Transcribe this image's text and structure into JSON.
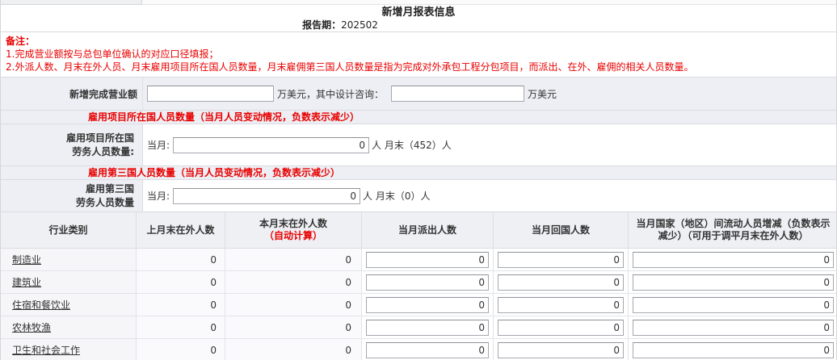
{
  "colors": {
    "accent_red": "#e80000",
    "section_bg": "#edeff4",
    "border": "#d9dbe0",
    "header_bg": "#eff0f4"
  },
  "header": {
    "title": "新增月报表信息",
    "report_period_label": "报告期：",
    "report_period_value": "202502"
  },
  "notes": {
    "label": "备注：",
    "line1": "1.完成营业额按与总包单位确认的对应口径填报；",
    "line2": "2.外派人数、月末在外人员、月末雇用项目所在国人员数量，月末雇佣第三国人员数量是指为完成对外承包工程分包项目，而派出、在外、雇佣的相关人员数量。"
  },
  "revenue": {
    "label": "新增完成营业额",
    "value": "",
    "unit_mid": "万美元，其中设计咨询：",
    "design_value": "",
    "unit_end": "万美元"
  },
  "host_country": {
    "section_header": "雇用项目所在国人员数量（当月人员变动情况，负数表示减少）",
    "label_line1": "雇用项目所在国",
    "label_line2": "劳务人员数量:",
    "month_label": "当月:",
    "month_value": "0",
    "suffix": "人 月末（452）人"
  },
  "third_country": {
    "section_header": "雇用第三国人员数量（当月人员变动情况，负数表示减少）",
    "label_line1": "雇用第三国",
    "label_line2": "劳务人员数量",
    "month_label": "当月:",
    "month_value": "0",
    "suffix": "人 月末（0）人"
  },
  "table": {
    "headers": {
      "industry": "行业类别",
      "prev_month": "上月末在外人数",
      "curr_month": "本月末在外人数",
      "curr_month_auto": "（自动计算）",
      "dispatched": "当月派出人数",
      "returned": "当月回国人数",
      "flow": "当月国家（地区）间流动人员增减（负数表示减少）（可用于调平月末在外人数）"
    },
    "rows": [
      {
        "industry": "制造业",
        "prev": "0",
        "curr": "0",
        "dispatched": "0",
        "returned": "0",
        "flow": "0"
      },
      {
        "industry": "建筑业",
        "prev": "0",
        "curr": "0",
        "dispatched": "0",
        "returned": "0",
        "flow": "0"
      },
      {
        "industry": "住宿和餐饮业",
        "prev": "0",
        "curr": "0",
        "dispatched": "0",
        "returned": "0",
        "flow": "0"
      },
      {
        "industry": "农林牧渔",
        "prev": "0",
        "curr": "0",
        "dispatched": "0",
        "returned": "0",
        "flow": "0"
      },
      {
        "industry": "卫生和社会工作",
        "prev": "0",
        "curr": "0",
        "dispatched": "0",
        "returned": "0",
        "flow": "0"
      }
    ]
  }
}
